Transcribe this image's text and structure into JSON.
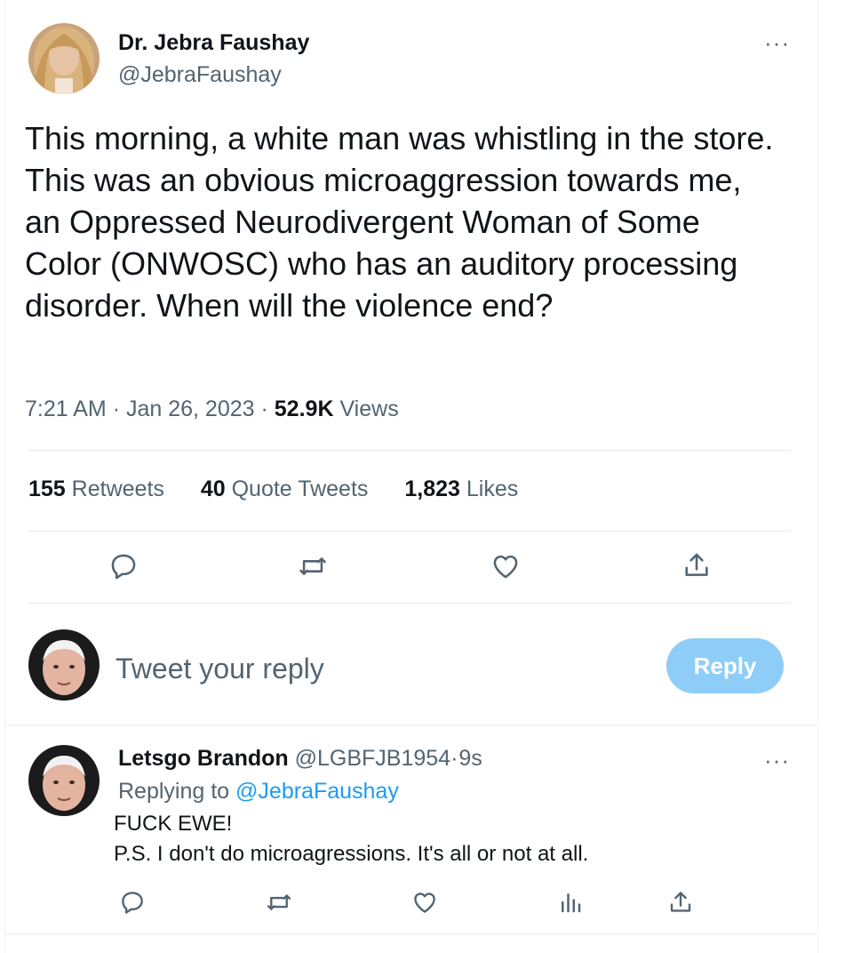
{
  "tweet": {
    "author_name": "Dr. Jebra Faushay",
    "author_handle": "@JebraFaushay",
    "text": "This morning, a white man was whistling in the store. This was an obvious microaggression towards me, an Oppressed Neurodivergent Woman of Some Color (ONWOSC) who has an auditory processing disorder. When will the violence end?",
    "time": "7:21 AM",
    "date": "Jan 26, 2023",
    "views_count": "52.9K",
    "views_label": "Views",
    "separator": "·",
    "more_icon": "···",
    "stats": [
      {
        "count": "155",
        "label": "Retweets"
      },
      {
        "count": "40",
        "label": "Quote Tweets"
      },
      {
        "count": "1,823",
        "label": "Likes"
      }
    ],
    "actions": [
      "reply-icon",
      "retweet-icon",
      "like-icon",
      "share-icon"
    ]
  },
  "composer": {
    "placeholder": "Tweet your reply",
    "button_label": "Reply",
    "button_color": "#8ecdf7"
  },
  "reply": {
    "author_name": "Letsgo Brandon",
    "author_handle": "@LGBFJB1954",
    "separator": "·",
    "time_ago": "9s",
    "replying_prefix": "Replying to",
    "replying_handle": "@JebraFaushay",
    "line1": "FUCK EWE!",
    "line2": "P.S. I don't do microagressions. It's all or not at all.",
    "more_icon": "···",
    "actions": [
      "reply-icon",
      "retweet-icon",
      "like-icon",
      "views-icon",
      "share-icon"
    ]
  },
  "colors": {
    "text": "#0f1419",
    "muted": "#536471",
    "link": "#1d9bf0",
    "divider": "#e7ebed"
  }
}
